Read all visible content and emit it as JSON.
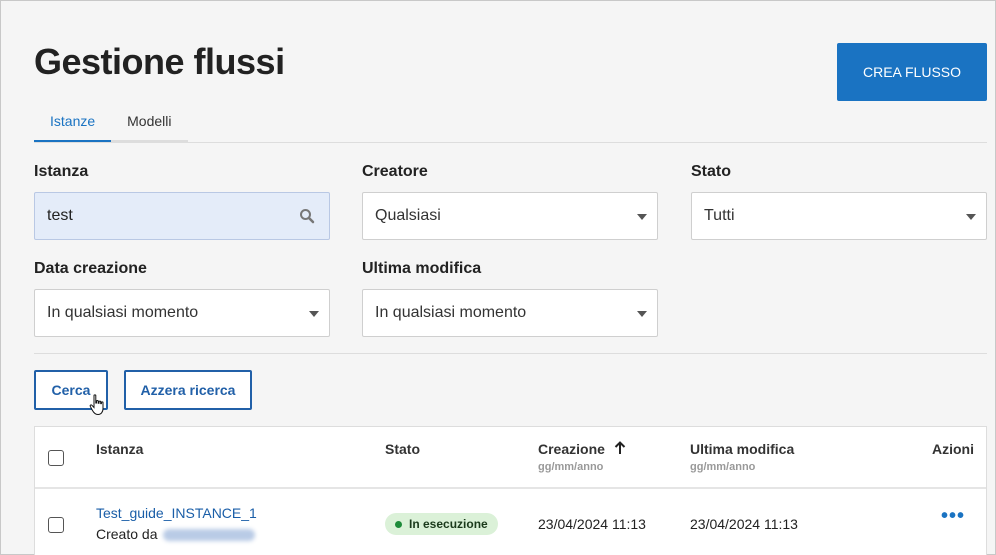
{
  "page": {
    "title": "Gestione flussi"
  },
  "header": {
    "create_button": "CREA FLUSSO"
  },
  "tabs": [
    {
      "label": "Istanze",
      "active": true
    },
    {
      "label": "Modelli",
      "active": false
    }
  ],
  "filters": {
    "instance": {
      "label": "Istanza",
      "value": "test"
    },
    "creator": {
      "label": "Creatore",
      "value": "Qualsiasi"
    },
    "status": {
      "label": "Stato",
      "value": "Tutti"
    },
    "created": {
      "label": "Data creazione",
      "value": "In qualsiasi momento"
    },
    "modified": {
      "label": "Ultima modifica",
      "value": "In qualsiasi momento"
    }
  },
  "actions": {
    "search": "Cerca",
    "reset": "Azzera ricerca"
  },
  "table": {
    "columns": {
      "instance": "Istanza",
      "status": "Stato",
      "created": "Creazione",
      "created_sub": "gg/mm/anno",
      "modified": "Ultima modifica",
      "modified_sub": "gg/mm/anno",
      "actions": "Azioni"
    },
    "rows": [
      {
        "name": "Test_guide_INSTANCE_1",
        "created_by_prefix": "Creato da",
        "status": "In esecuzione",
        "created": "23/04/2024 11:13",
        "modified": "23/04/2024 11:13"
      }
    ]
  },
  "colors": {
    "primary": "#1a73c2",
    "status_running": "#1e8b3a"
  }
}
